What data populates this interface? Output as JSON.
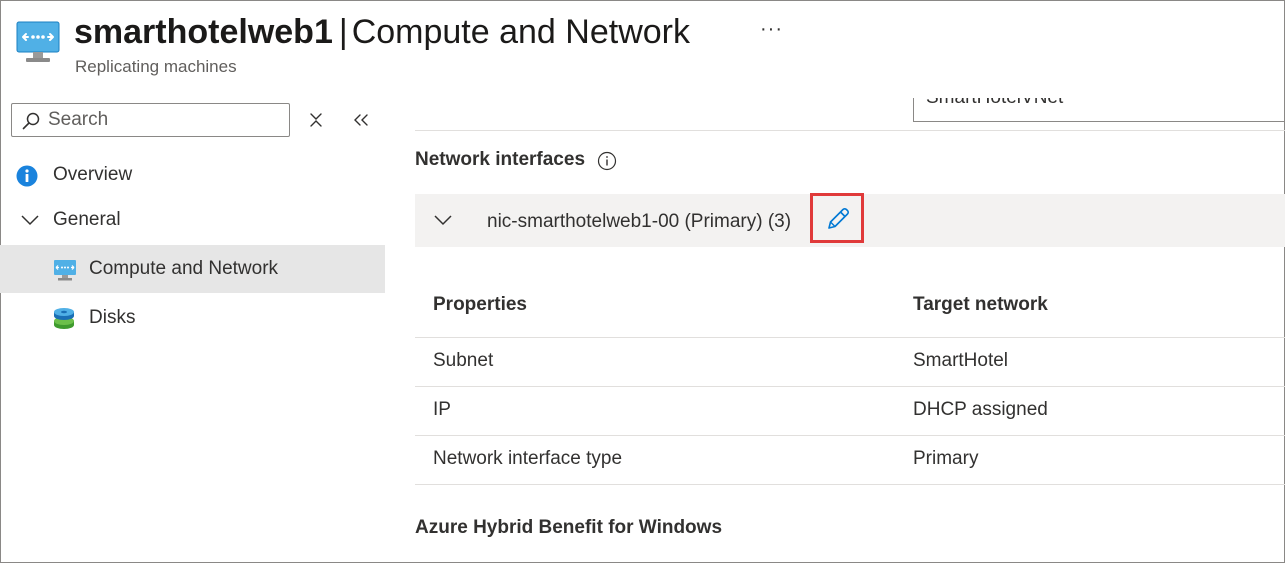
{
  "header": {
    "resource_name": "smarthotelweb1",
    "separator": "|",
    "page_name": "Compute and Network",
    "subtitle": "Replicating machines",
    "more_label": "···"
  },
  "sidebar": {
    "search_placeholder": "Search",
    "items": [
      {
        "label": "Overview",
        "icon": "info-icon"
      },
      {
        "label": "General",
        "icon": "chevron-down-icon"
      },
      {
        "label": "Compute and Network",
        "icon": "virtual-machine-icon",
        "selected": true
      },
      {
        "label": "Disks",
        "icon": "disks-icon"
      }
    ]
  },
  "main": {
    "vnet_value": "SmartHotelVNet",
    "network_interfaces_title": "Network interfaces",
    "nic": {
      "label": "nic-smarthotelweb1-00 (Primary) (3)"
    },
    "table": {
      "headers": [
        "Properties",
        "Target network"
      ],
      "rows": [
        [
          "Subnet",
          "SmartHotel"
        ],
        [
          "IP",
          "DHCP assigned"
        ],
        [
          "Network interface type",
          "Primary"
        ]
      ]
    },
    "ahb_title": "Azure Hybrid Benefit for Windows"
  },
  "colors": {
    "accent": "#0078d4",
    "highlight_border": "#e03a3a",
    "selected_nav": "#e6e6e6",
    "nic_bar": "#f3f2f1"
  }
}
